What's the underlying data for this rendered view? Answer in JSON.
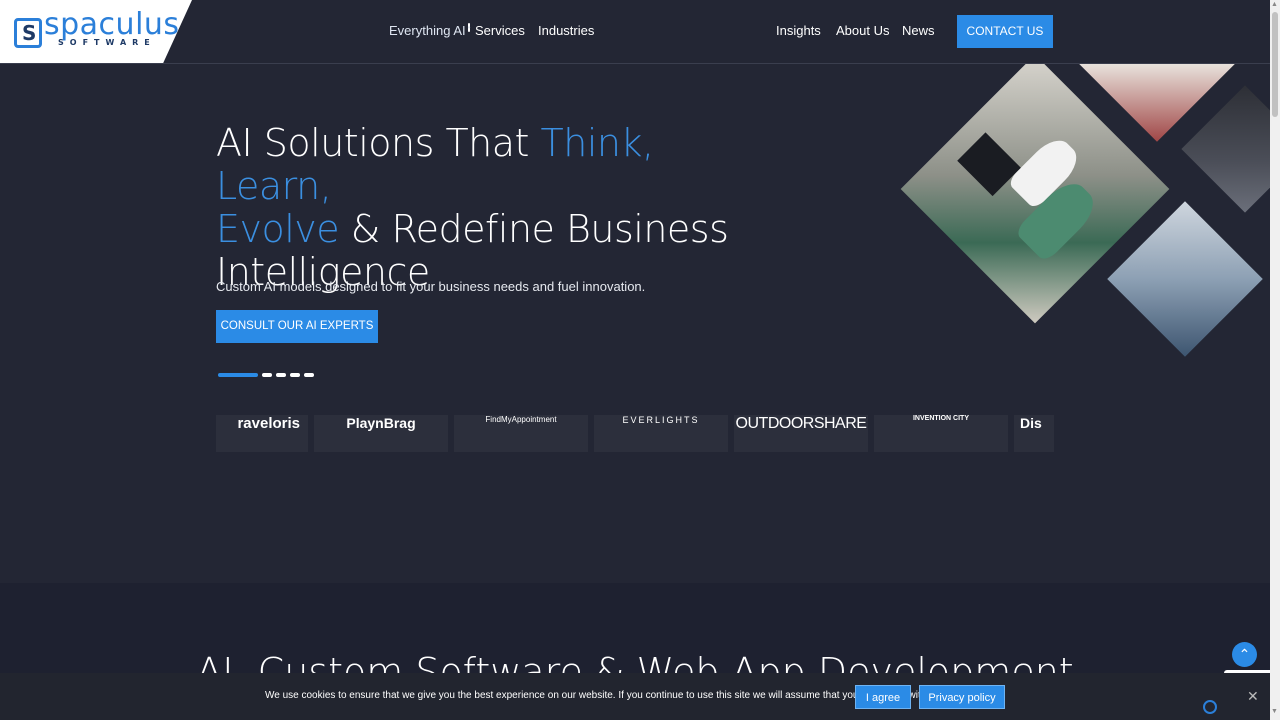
{
  "brand": {
    "name": "spaculus",
    "tagline": "SOFTWARE",
    "primary_color": "#2b8be6",
    "bg_color": "#232634"
  },
  "nav": {
    "everything_ai": "Everything AI",
    "services": "Services",
    "industries": "Industries",
    "insights": "Insights",
    "about": "About Us",
    "news": "News",
    "contact": "CONTACT US"
  },
  "hero": {
    "title_part1": "AI Solutions That ",
    "title_accent1": "Think, Learn,",
    "title_accent2": "Evolve",
    "title_part2": " & Redefine Business Intelligence",
    "subtitle": "Custom AI models designed to fit your business needs and fuel innovation.",
    "cta": "CONSULT OUR AI EXPERTS",
    "slides_total": 5,
    "active_slide": 1
  },
  "client_logos": [
    {
      "label": "raveloris"
    },
    {
      "label": "PlaynBrag"
    },
    {
      "label": "FindMyAppointment"
    },
    {
      "label": "EVERLIGHTS"
    },
    {
      "label": "OUTDOORSHARE"
    },
    {
      "label": "INVENTION CITY"
    },
    {
      "label": "Dis"
    }
  ],
  "section2": {
    "title": "AI, Custom Software & Web App Development"
  },
  "cookie": {
    "text": "We use cookies to ensure that we give you the best experience on our website. If you continue to use this site we will assume that you are happy with it.",
    "agree": "I agree",
    "policy": "Privacy policy",
    "close": "✕"
  },
  "icons": {
    "back_to_top": "chevron-up-icon",
    "cookie_close": "close-icon",
    "cookie_settings": "cookie-settings-icon"
  }
}
